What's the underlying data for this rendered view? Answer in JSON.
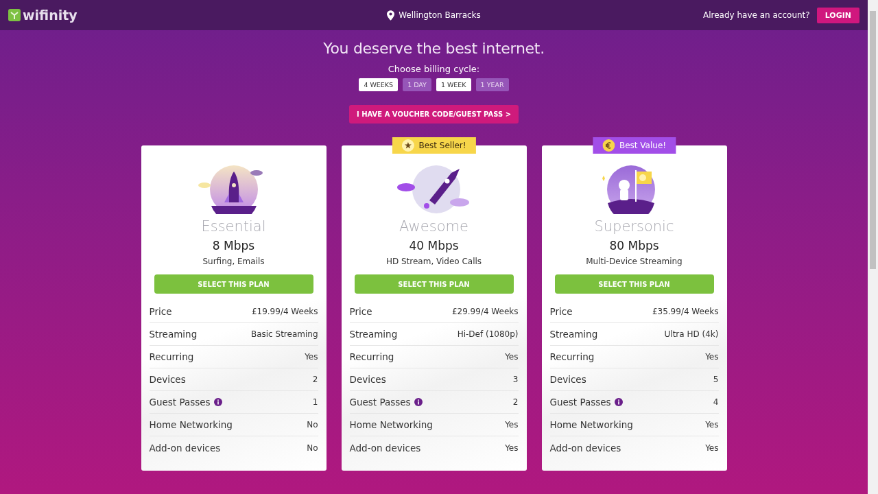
{
  "header": {
    "logo": "wifinity",
    "location": "Wellington Barracks",
    "account_prompt": "Already have an account?",
    "login": "LOGIN"
  },
  "headline": "You deserve the best internet.",
  "billing": {
    "label": "Choose billing cycle:",
    "options": [
      {
        "label": "4 WEEKS",
        "selected": true
      },
      {
        "label": "1 DAY",
        "selected": false
      },
      {
        "label": "1 WEEK",
        "selected": true
      },
      {
        "label": "1 YEAR",
        "selected": false
      }
    ]
  },
  "voucher_button": "I HAVE A VOUCHER CODE/GUEST PASS >",
  "plans": [
    {
      "name": "Essential",
      "speed": "8 Mbps",
      "use": "Surfing, Emails",
      "kind": "rocket",
      "button": "SELECT THIS PLAN",
      "features": [
        {
          "label": "Price",
          "value": "£19.99/4 Weeks",
          "info": false
        },
        {
          "label": "Streaming",
          "value": "Basic Streaming",
          "info": false
        },
        {
          "label": "Recurring",
          "value": "Yes",
          "info": false
        },
        {
          "label": "Devices",
          "value": "2",
          "info": false
        },
        {
          "label": "Guest Passes",
          "value": "1",
          "info": true
        },
        {
          "label": "Home Networking",
          "value": "No",
          "info": false
        },
        {
          "label": "Add-on devices",
          "value": "No",
          "info": false
        }
      ]
    },
    {
      "name": "Awesome",
      "speed": "40 Mbps",
      "use": "HD Stream, Video Calls",
      "kind": "rocket-flying",
      "button": "SELECT THIS PLAN",
      "badge": {
        "label": "Best Seller!",
        "kind": "star",
        "color": "#f7d64a"
      },
      "features": [
        {
          "label": "Price",
          "value": "£29.99/4 Weeks",
          "info": false
        },
        {
          "label": "Streaming",
          "value": "Hi-Def (1080p)",
          "info": false
        },
        {
          "label": "Recurring",
          "value": "Yes",
          "info": false
        },
        {
          "label": "Devices",
          "value": "3",
          "info": false
        },
        {
          "label": "Guest Passes",
          "value": "2",
          "info": true
        },
        {
          "label": "Home Networking",
          "value": "Yes",
          "info": false
        },
        {
          "label": "Add-on devices",
          "value": "Yes",
          "info": false
        }
      ]
    },
    {
      "name": "Supersonic",
      "speed": "80 Mbps",
      "use": "Multi-Device Streaming",
      "kind": "astronaut",
      "button": "SELECT THIS PLAN",
      "badge": {
        "label": "Best Value!",
        "kind": "euro",
        "color": "#a24ee8"
      },
      "features": [
        {
          "label": "Price",
          "value": "£35.99/4 Weeks",
          "info": false
        },
        {
          "label": "Streaming",
          "value": "Ultra HD (4k)",
          "info": false
        },
        {
          "label": "Recurring",
          "value": "Yes",
          "info": false
        },
        {
          "label": "Devices",
          "value": "5",
          "info": false
        },
        {
          "label": "Guest Passes",
          "value": "4",
          "info": true
        },
        {
          "label": "Home Networking",
          "value": "Yes",
          "info": false
        },
        {
          "label": "Add-on devices",
          "value": "Yes",
          "info": false
        }
      ]
    }
  ]
}
